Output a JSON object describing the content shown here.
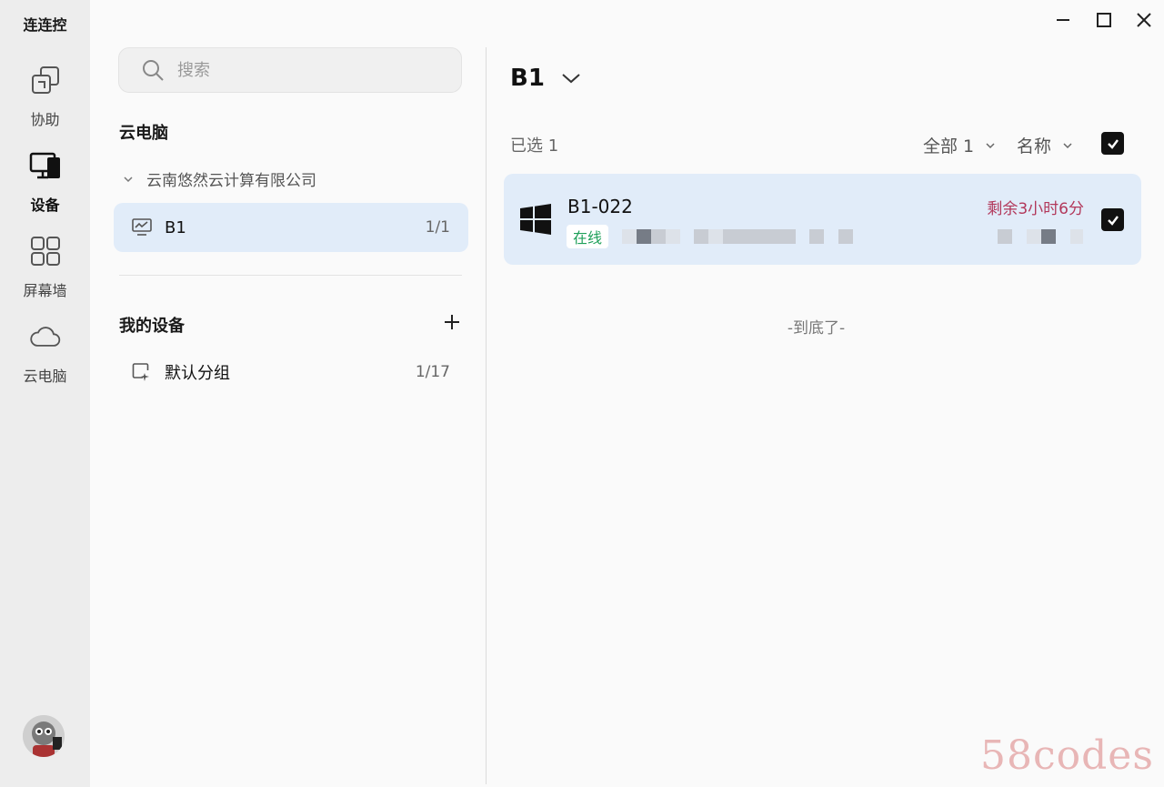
{
  "app": {
    "title": "连连控"
  },
  "rail": {
    "items": [
      {
        "label": "协助",
        "icon": "assist-icon"
      },
      {
        "label": "设备",
        "icon": "device-icon"
      },
      {
        "label": "屏幕墙",
        "icon": "screen-wall-icon"
      },
      {
        "label": "云电脑",
        "icon": "cloud-icon"
      }
    ],
    "active": "设备"
  },
  "middle": {
    "search": {
      "placeholder": "搜索",
      "value": ""
    },
    "cloud_section": {
      "title": "云电脑",
      "company": "云南悠然云计算有限公司",
      "groups": [
        {
          "name": "B1",
          "count": "1/1",
          "selected": true
        }
      ]
    },
    "my_devices": {
      "title": "我的设备",
      "groups": [
        {
          "name": "默认分组",
          "count": "1/17"
        }
      ]
    }
  },
  "right": {
    "group_title": "B1",
    "selected_text": "已选 1",
    "filter_all": "全部 1",
    "sort_name": "名称",
    "devices": [
      {
        "name": "B1-022",
        "status": "在线",
        "remaining": "剩余3小时6分",
        "checked": true,
        "os": "windows"
      }
    ],
    "end_note": "-到底了-"
  },
  "watermark": "58codes",
  "colors": {
    "selected_bg": "#e1ecf9",
    "online": "#1fa05a",
    "remaining": "#b2375a"
  }
}
